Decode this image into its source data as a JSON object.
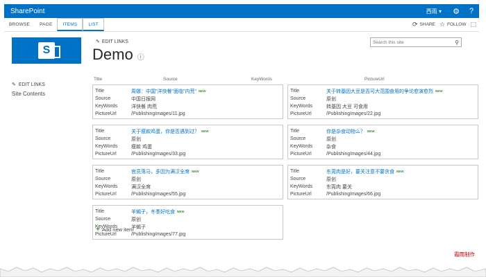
{
  "suitebar": {
    "brand": "SharePoint",
    "user": "西雨 ▾",
    "settings_icon": "gear-icon",
    "help_icon": "question-icon"
  },
  "ribbon": {
    "tabs": [
      "BROWSE",
      "PAGE",
      "ITEMS",
      "LIST"
    ],
    "active_tab": "ITEMS",
    "share": "SHARE",
    "follow": "FOLLOW"
  },
  "header": {
    "edit_links": "EDIT LINKS",
    "title": "Demo",
    "search_placeholder": "Search this site"
  },
  "leftnav": {
    "edit_links": "EDIT LINKS",
    "site_contents": "Site Contents"
  },
  "columns": [
    "Title",
    "Source",
    "KeyWords",
    "PictureUrl"
  ],
  "labels": {
    "title": "Title",
    "source": "Source",
    "keywords": "KeyWords",
    "pictureurl": "PictureUrl",
    "new_badge": "NEW"
  },
  "items": [
    {
      "title": "周娜：中国\"洋快餐\"面临\"内荒\"",
      "source": "中国日报网",
      "keywords": "洋快餐 肉荒",
      "pictureurl": "/PublishingImages/11.jpg"
    },
    {
      "title": "关于转基因大豆是否可大范围食用的争论愈演愈烈",
      "source": "原创",
      "keywords": "转基因 大豆 可食用",
      "pictureurl": "/PublishingImages/22.jpg"
    },
    {
      "title": "关于瘦款鸡蛋，你是否遇到过？",
      "source": "原创",
      "keywords": "瘦款 鸡蛋",
      "pictureurl": "/PublishingImages/33.jpg"
    },
    {
      "title": "你是杂食动物么？",
      "source": "原创",
      "keywords": "杂食",
      "pictureurl": "/PublishingImages/44.jpg"
    },
    {
      "title": "官员落马，多因为满汉全席",
      "source": "原创",
      "keywords": "满汉全席",
      "pictureurl": "/PublishingImages/55.jpg"
    },
    {
      "title": "东莞肉是好，要关注意不要贪食",
      "source": "原创",
      "keywords": "东莞肉 要关",
      "pictureurl": "/PublishingImages/66.jpg"
    },
    {
      "title": "羊蝎子，冬季好吃食",
      "source": "原创",
      "keywords": "羊蝎子",
      "pictureurl": "/PublishingImages/77.jpg"
    }
  ],
  "footer": {
    "add_new": "Add new item",
    "credit": "霜雨制作"
  },
  "colors": {
    "brand_blue": "#0072c6",
    "credit_red": "#c00000",
    "new_green": "#3a8a3a"
  }
}
